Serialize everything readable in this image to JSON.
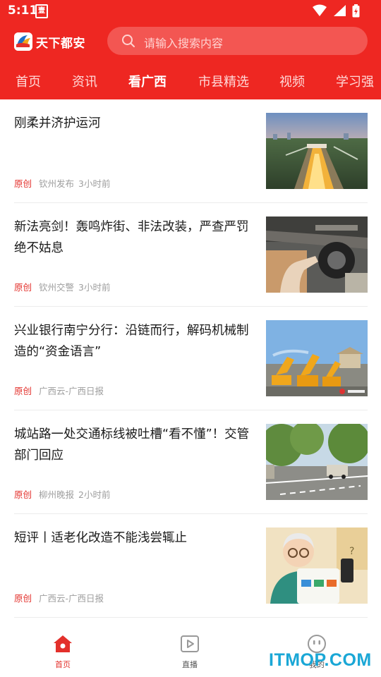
{
  "status_bar": {
    "time": "5:11",
    "app_icon_label": "壹",
    "icons": [
      "wifi-icon",
      "signal-icon",
      "battery-icon"
    ]
  },
  "header": {
    "logo_text": "天下都安",
    "search_placeholder": "请输入搜索内容",
    "accent_color": "#ee2722"
  },
  "tabs": [
    {
      "label": "首页",
      "active": false
    },
    {
      "label": "资讯",
      "active": false
    },
    {
      "label": "看广西",
      "active": true
    },
    {
      "label": "市县精选",
      "active": false
    },
    {
      "label": "视频",
      "active": false
    },
    {
      "label": "学习强",
      "active": false
    }
  ],
  "feed": [
    {
      "title": "刚柔并济护运河",
      "tag": "原创",
      "source": "钦州发布",
      "time": "3小时前",
      "thumb": "canal-dusk-photo"
    },
    {
      "title": "新法亮剑！轰鸣炸街、非法改装，严查严罚绝不姑息",
      "tag": "原创",
      "source": "钦州交警",
      "time": "3小时前",
      "thumb": "car-underside-inspection-photo"
    },
    {
      "title": "兴业银行南宁分行：沿链而行，解码机械制造的“资金语言”",
      "tag": "原创",
      "source": "广西云-广西日报",
      "time": "",
      "thumb": "excavators-yard-photo"
    },
    {
      "title": "城站路一处交通标线被吐槽“看不懂”！交管部门回应",
      "tag": "原创",
      "source": "柳州晚报",
      "time": "2小时前",
      "thumb": "street-road-markings-photo"
    },
    {
      "title": "短评丨适老化改造不能浅尝辄止",
      "tag": "原创",
      "source": "广西云-广西日报",
      "time": "",
      "thumb": "elderly-man-phone-illustration"
    }
  ],
  "bottom_nav": [
    {
      "label": "首页",
      "icon": "home-icon",
      "active": true
    },
    {
      "label": "直播",
      "icon": "live-play-icon",
      "active": false
    },
    {
      "label": "我的",
      "icon": "smiley-profile-icon",
      "active": false
    }
  ],
  "watermark": "ITMOP.COM"
}
